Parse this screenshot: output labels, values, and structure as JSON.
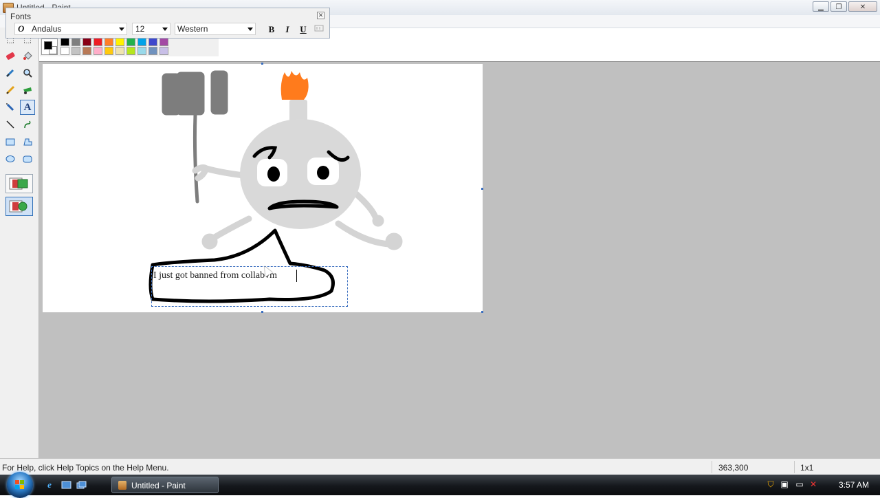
{
  "window": {
    "title": "Untitled - Paint",
    "minimize_icon": "minimize-icon",
    "maximize_icon": "maximize-icon",
    "close_icon": "close-icon"
  },
  "fonts_toolbar": {
    "title": "Fonts",
    "font_name": "Andalus",
    "font_size": "12",
    "script": "Western",
    "bold": "B",
    "italic": "I",
    "underline": "U"
  },
  "toolbox": {
    "tools": [
      "free-form-select",
      "select",
      "eraser",
      "fill-with-color",
      "pick-color",
      "magnifier",
      "pencil",
      "brush",
      "airbrush",
      "text",
      "line",
      "curve",
      "rectangle",
      "polygon",
      "ellipse",
      "rounded-rectangle"
    ],
    "active_tool": "text",
    "transparency_modes": [
      "opaque",
      "transparent"
    ],
    "active_transparency": "transparent"
  },
  "palette": {
    "foreground": "#000000",
    "background": "#ffffff",
    "top_row": [
      "#000000",
      "#7f7f7f",
      "#880015",
      "#ed1c24",
      "#ff7f27",
      "#fff200",
      "#22b14c",
      "#00a2e8",
      "#3f48cc",
      "#a349a4"
    ],
    "bottom_row": [
      "#ffffff",
      "#c3c3c3",
      "#b97a57",
      "#ffaec9",
      "#ffc90e",
      "#efe4b0",
      "#b5e61d",
      "#99d9ea",
      "#7092be",
      "#c8bfe7"
    ]
  },
  "canvas": {
    "text_entry": "I just got banned from collabvm"
  },
  "status": {
    "help": "For Help, click Help Topics on the Help Menu.",
    "coords": "363,300",
    "size": "1x1"
  },
  "taskbar": {
    "task_label": "Untitled - Paint",
    "clock": "3:57 AM"
  }
}
